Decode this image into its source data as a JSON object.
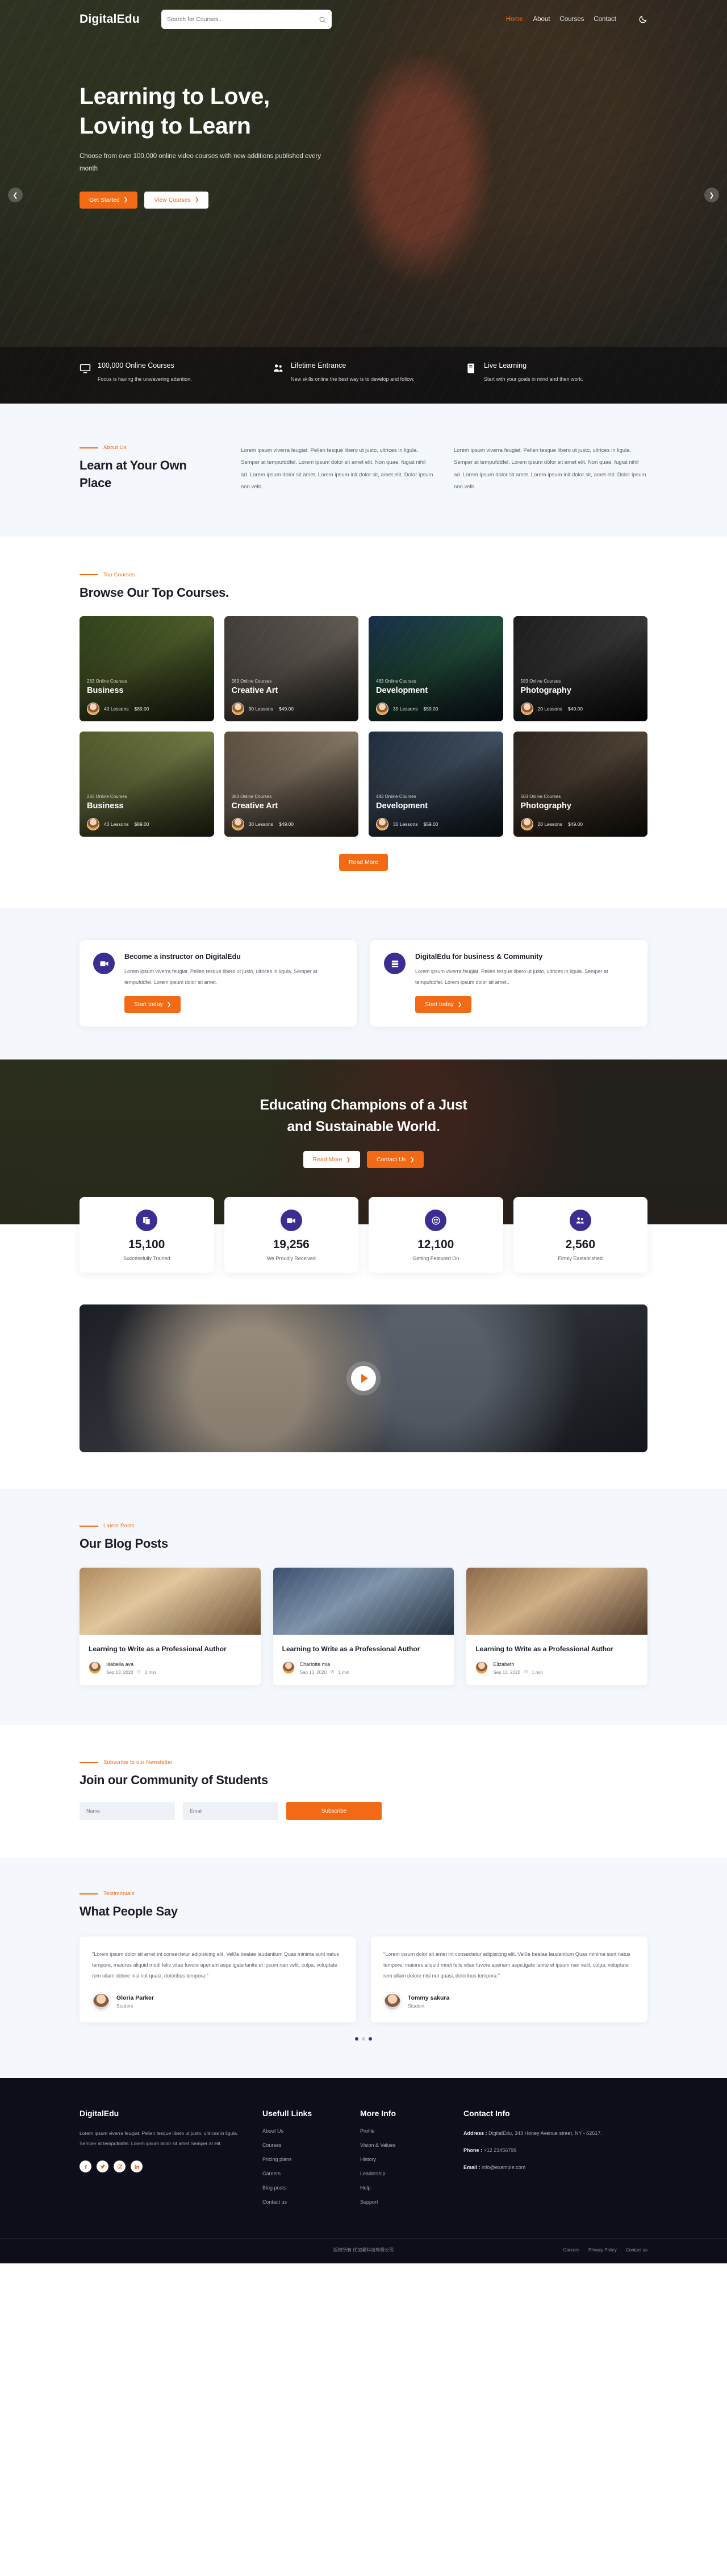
{
  "nav": {
    "brand": "DigitalEdu",
    "search_placeholder": "Search for Courses..",
    "links": [
      {
        "label": "Home",
        "active": true
      },
      {
        "label": "About",
        "active": false
      },
      {
        "label": "Courses",
        "active": false
      },
      {
        "label": "Contact",
        "active": false
      }
    ],
    "theme_icon": "moon-icon"
  },
  "hero": {
    "title": "Learning to Love, Loving to Learn",
    "subtitle": "Choose from over 100,000 online video courses with new additions published every month",
    "primary_btn": "Get Started",
    "secondary_btn": "View Courses",
    "features": [
      {
        "icon": "monitor-icon",
        "title": "100,000 Online Courses",
        "desc": "Focus is having the unwavering attention."
      },
      {
        "icon": "users-icon",
        "title": "Lifetime Entrance",
        "desc": "New skills online the best way is to develop and follow."
      },
      {
        "icon": "book-icon",
        "title": "Live Learning",
        "desc": "Start with your goals in mind and then work."
      }
    ]
  },
  "about": {
    "eyebrow": "About Us",
    "title": "Learn at Your Own Place",
    "col1": "Lorem ipsum viverra feugiat. Pellen tesque libero ut justo, ultrices in ligula. Semper at tempufddfel. Lorem ipsum dolor sit amet elit. Non quae, fugiat nihil ad. Lorem ipsum dolor sit amet. Lorem ipsum init dolor sit, amet elit. Dolor ipsum non velit.",
    "col2": "Lorem ipsum viverra feugiat. Pellen tesque libero ut justo, ultrices in ligula. Semper at tempufddfel. Lorem ipsum dolor sit amet elit. Non quae, fugiat nihil ad. Lorem ipsum dolor sit amet. Lorem ipsum init dolor sit, amet elit. Dolor ipsum non velit."
  },
  "courses": {
    "eyebrow": "Top Courses",
    "title": "Browse Our Top Courses.",
    "read_more": "Read More",
    "items": [
      {
        "count": "283 Online Courses",
        "title": "Business",
        "lessons": "40 Lessons",
        "price": "$89.00"
      },
      {
        "count": "383 Online Courses",
        "title": "Creative Art",
        "lessons": "30 Lessons",
        "price": "$49.00"
      },
      {
        "count": "483 Online Courses",
        "title": "Development",
        "lessons": "30 Lessons",
        "price": "$59.00"
      },
      {
        "count": "583 Online Courses",
        "title": "Photography",
        "lessons": "20 Lessons",
        "price": "$49.00"
      },
      {
        "count": "283 Online Courses",
        "title": "Business",
        "lessons": "40 Lessons",
        "price": "$89.00"
      },
      {
        "count": "383 Online Courses",
        "title": "Creative Art",
        "lessons": "30 Lessons",
        "price": "$49.00"
      },
      {
        "count": "483 Online Courses",
        "title": "Development",
        "lessons": "30 Lessons",
        "price": "$59.00"
      },
      {
        "count": "583 Online Courses",
        "title": "Photography",
        "lessons": "20 Lessons",
        "price": "$49.00"
      }
    ]
  },
  "cta": {
    "cards": [
      {
        "icon": "video-camera-icon",
        "title": "Become a instructor on DigitalEdu",
        "desc": "Lorem ipsum viverra feugiat. Pellen tesque libero ut justo, ultrices in ligula. Semper at tempufddfel. Lorem ipsum dolor sit amet.",
        "btn": "Start today"
      },
      {
        "icon": "server-icon",
        "title": "DigitalEdu for business & Community",
        "desc": "Lorem ipsum viverra feugiat. Pellen tesque libero ut justo, ultrices in ligula. Semper at tempufddfel. Lorem ipsum dolor sit amet..",
        "btn": "Start today"
      }
    ]
  },
  "banner": {
    "title_line1": "Educating Champions of a Just",
    "title_line2": "and Sustainable World.",
    "btn_read": "Read More",
    "btn_contact": "Contact Us"
  },
  "stats": [
    {
      "icon": "copy-icon",
      "number": "15,100",
      "label": "Successfully Trained"
    },
    {
      "icon": "video-camera-icon",
      "number": "19,256",
      "label": "We Proudly Received"
    },
    {
      "icon": "smiley-icon",
      "number": "12,100",
      "label": "Getting Featured On"
    },
    {
      "icon": "users-icon",
      "number": "2,560",
      "label": "Firmly Eastablished"
    }
  ],
  "video": {
    "play_label": "play-button"
  },
  "blog": {
    "eyebrow": "Latest Posts",
    "title": "Our Blog Posts",
    "posts": [
      {
        "title": "Learning to Write as a Professional Author",
        "author": "Isabella ava",
        "date": "Sep 13, 2020",
        "read": "1 min"
      },
      {
        "title": "Learning to Write as a Professional Author",
        "author": "Charlotte mia",
        "date": "Sep 13, 2020",
        "read": "1 min"
      },
      {
        "title": "Learning to Write as a Professional Author",
        "author": "Elizabeth",
        "date": "Sep 13, 2020",
        "read": "1 min"
      }
    ]
  },
  "newsletter": {
    "eyebrow": "Subscribe to our Newsletter",
    "title": "Join our Community of Students",
    "name_placeholder": "Name",
    "email_placeholder": "Email",
    "button": "Subscribe"
  },
  "testimonials": {
    "eyebrow": "Testimonials",
    "title": "What People Say",
    "items": [
      {
        "quote": "\"Lorem ipsum dolor sit amet int consectetur adipisicing elit. Vel0a beatae laudantium Quas minima sunt natus tempore, maiores aliquid modi felis vitae fuvore aperiam aspe.igate lanite et ipsum nan velit, culpa. voluptate rem ullam dolore nisi nut quasi, doloribus tempora.\"",
        "name": "Gloria Parker",
        "role": "Student"
      },
      {
        "quote": "\"Lorem ipsum dolor sit amet int consectetur adipisicing elit. Vel0a beatae laudantium Quas minima sunt natus tempore, maiores aliquid modi felis vitae fuvore aperiam aspe.igate lanite et ipsum nan velit, culpa. voluptate rem ullam dolore nisi nut quasi, doloribus tempora.\"",
        "name": "Tommy sakura",
        "role": "Student"
      }
    ]
  },
  "footer": {
    "brand": "DigitalEdu",
    "desc": "Lorem ipsum viverra feugiat. Pellen tesque libero ut justo, ultrices in ligula. Semper at tempufddfel. Lorem ipsum dolor sit amet Semper at elit.",
    "social": [
      "facebook-icon",
      "twitter-icon",
      "instagram-icon",
      "linkedin-icon"
    ],
    "useful_title": "Usefull Links",
    "useful_links": [
      "About Us",
      "Courses",
      "Pricing plans",
      "Careers",
      "Blog posts",
      "Contact us"
    ],
    "more_title": "More Info",
    "more_links": [
      "Profile",
      "Vision & Values",
      "History",
      "Leadership",
      "Help",
      "Support"
    ],
    "contact_title": "Contact Info",
    "address_label": "Address :",
    "address_value": " DigitalEdu, 343 Honey Avenue street, NY - 62617.",
    "phone_label": "Phone :",
    "phone_value": " +12 23456799",
    "email_label": "Email :",
    "email_value": " info@example.com",
    "copyright": "版权所有 优加星科技有限公司",
    "bottom_links": [
      "Careers",
      "Privacy Policy",
      "Contact us"
    ]
  },
  "colors": {
    "accent": "#f26a16",
    "purple": "#3b2e93",
    "dark": "#0e0d1a",
    "light_bg": "#f4f7fb"
  }
}
